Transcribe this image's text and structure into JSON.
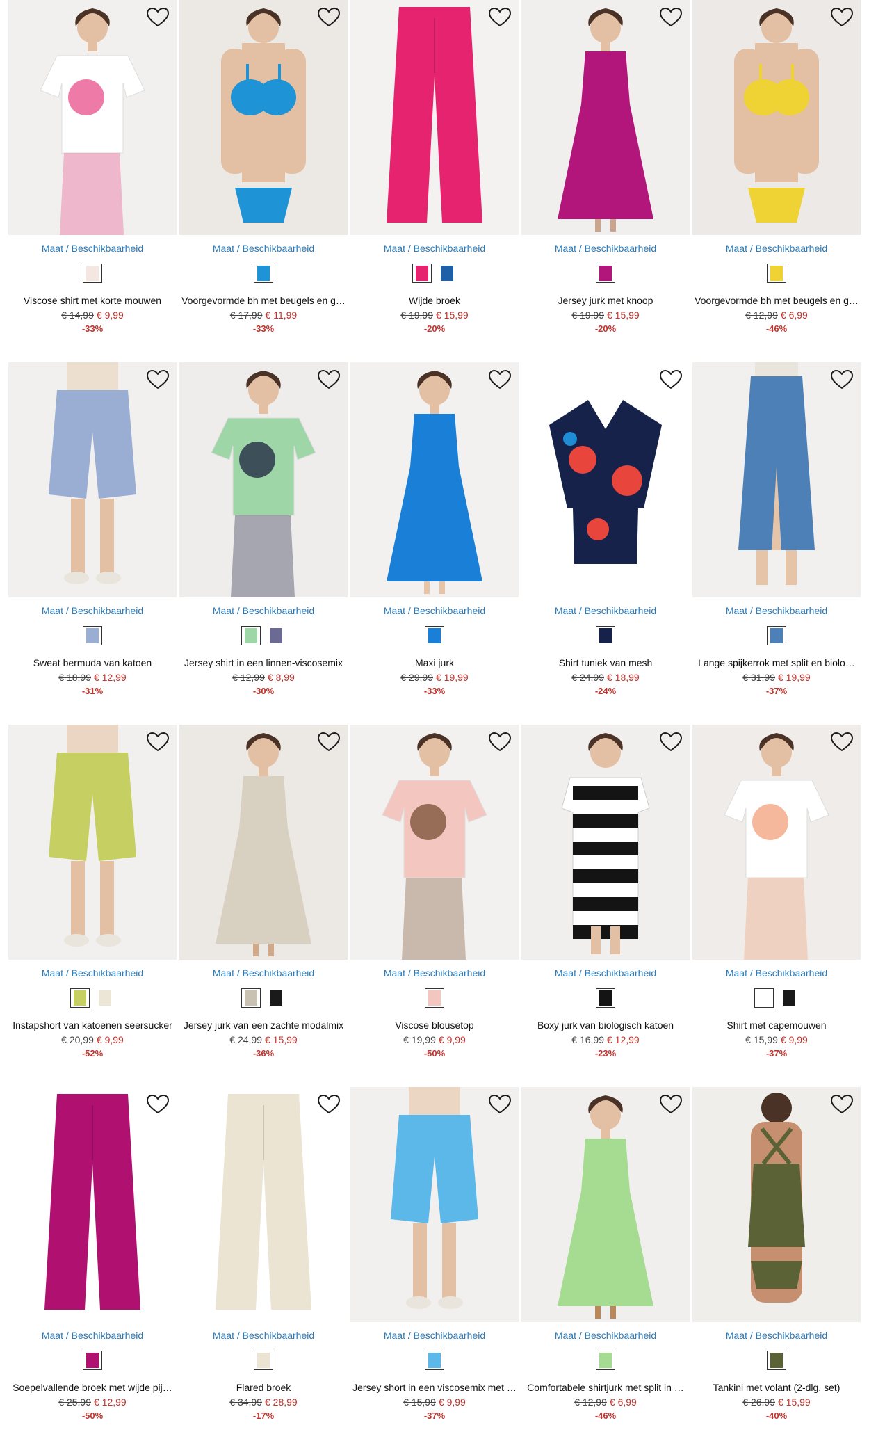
{
  "ui": {
    "availability_label": "Maat / Beschikbaarheid",
    "wishlist_icon": "heart-outline-icon",
    "colors": {
      "link": "#2b7bb9",
      "sale": "#c2342d"
    }
  },
  "products": [
    {
      "name": "Viscose shirt met korte mouwen",
      "old_price": "€ 14,99",
      "new_price": "€ 9,99",
      "discount": "-33%",
      "bg": "#f2f0ee",
      "item": "#ffffff",
      "accent": "#e84d8a",
      "shape": "top",
      "swatches": [
        "#f4e6e0"
      ]
    },
    {
      "name": "Voorgevormde bh met beugels en g…",
      "old_price": "€ 17,99",
      "new_price": "€ 11,99",
      "discount": "-33%",
      "bg": "#ece9e5",
      "item": "#1e94d6",
      "accent": "#c9a58d",
      "shape": "bra",
      "swatches": [
        "#1e94d6"
      ]
    },
    {
      "name": "Wijde broek",
      "old_price": "€ 19,99",
      "new_price": "€ 15,99",
      "discount": "-20%",
      "bg": "#f4f2f0",
      "item": "#e5236e",
      "accent": "#ffffff",
      "shape": "pants",
      "swatches": [
        "#e5236e",
        "#1f5fa8"
      ]
    },
    {
      "name": "Jersey jurk met knoop",
      "old_price": "€ 19,99",
      "new_price": "€ 15,99",
      "discount": "-20%",
      "bg": "#f1efed",
      "item": "#b3167a",
      "accent": "#c9a58d",
      "shape": "dress",
      "swatches": [
        "#b3167a"
      ]
    },
    {
      "name": "Voorgevormde bh met beugels en g…",
      "old_price": "€ 12,99",
      "new_price": "€ 6,99",
      "discount": "-46%",
      "bg": "#ece9e6",
      "item": "#efd335",
      "accent": "#d6a98b",
      "shape": "bra",
      "swatches": [
        "#efd335"
      ]
    },
    {
      "name": "Sweat bermuda van katoen",
      "old_price": "€ 18,99",
      "new_price": "€ 12,99",
      "discount": "-31%",
      "bg": "#f2f0ee",
      "item": "#9aaed3",
      "accent": "#e9d3bd",
      "shape": "shorts",
      "swatches": [
        "#9aaed3"
      ]
    },
    {
      "name": "Jersey shirt in een linnen-viscosemix",
      "old_price": "€ 12,99",
      "new_price": "€ 8,99",
      "discount": "-30%",
      "bg": "#efedeb",
      "item": "#9fd6a8",
      "accent": "#1c2340",
      "shape": "top",
      "swatches": [
        "#9fd6a8",
        "#6b6a93"
      ]
    },
    {
      "name": "Maxi jurk",
      "old_price": "€ 29,99",
      "new_price": "€ 19,99",
      "discount": "-33%",
      "bg": "#f3f1ef",
      "item": "#1a7fd6",
      "accent": "#e6c4a8",
      "shape": "dress",
      "swatches": [
        "#1a7fd6"
      ]
    },
    {
      "name": "Shirt tuniek van mesh",
      "old_price": "€ 24,99",
      "new_price": "€ 18,99",
      "discount": "-24%",
      "bg": "#ffffff",
      "item": "#16224a",
      "accent": "#e8453c",
      "shape": "tunic",
      "swatches": [
        "#16224a"
      ]
    },
    {
      "name": "Lange spijkerrok met split en biolo…",
      "old_price": "€ 31,99",
      "new_price": "€ 19,99",
      "discount": "-37%",
      "bg": "#f2f0ee",
      "item": "#4d80b6",
      "accent": "#e6c4a8",
      "shape": "skirt",
      "swatches": [
        "#4d80b6"
      ]
    },
    {
      "name": "Instapshort van katoenen seersucker",
      "old_price": "€ 20,99",
      "new_price": "€ 9,99",
      "discount": "-52%",
      "bg": "#f2f0ee",
      "item": "#c6cf62",
      "accent": "#e6c4a8",
      "shape": "shorts",
      "swatches": [
        "#c6cf62",
        "#ece6d6"
      ]
    },
    {
      "name": "Jersey jurk van een zachte modalmix",
      "old_price": "€ 24,99",
      "new_price": "€ 15,99",
      "discount": "-36%",
      "bg": "#ece8e3",
      "item": "#d8d1c2",
      "accent": "#d2a88a",
      "shape": "dress",
      "swatches": [
        "#c9c1b1",
        "#1a1a1a"
      ]
    },
    {
      "name": "Viscose blousetop",
      "old_price": "€ 19,99",
      "new_price": "€ 9,99",
      "discount": "-50%",
      "bg": "#f3f1ef",
      "item": "#f3c7c0",
      "accent": "#7a4f35",
      "shape": "top",
      "swatches": [
        "#f3c7c0"
      ]
    },
    {
      "name": "Boxy jurk van biologisch katoen",
      "old_price": "€ 16,99",
      "new_price": "€ 12,99",
      "discount": "-23%",
      "bg": "#f1efed",
      "item": "#141414",
      "accent": "#ffffff",
      "shape": "stripe",
      "swatches": [
        "#141414"
      ]
    },
    {
      "name": "Shirt met capemouwen",
      "old_price": "€ 15,99",
      "new_price": "€ 9,99",
      "discount": "-37%",
      "bg": "#efece9",
      "item": "#ffffff",
      "accent": "#f2a07c",
      "shape": "top",
      "swatches": [
        "#ffffff",
        "#1a1a1a"
      ]
    },
    {
      "name": "Soepelvallende broek met wijde pij…",
      "old_price": "€ 25,99",
      "new_price": "€ 12,99",
      "discount": "-50%",
      "bg": "#ffffff",
      "item": "#b0106f",
      "accent": "#b0106f",
      "shape": "pants",
      "swatches": [
        "#b0106f"
      ]
    },
    {
      "name": "Flared broek",
      "old_price": "€ 34,99",
      "new_price": "€ 28,99",
      "discount": "-17%",
      "bg": "#ffffff",
      "item": "#ebe4d3",
      "accent": "#8ea6c4",
      "shape": "pants",
      "swatches": [
        "#ebe4d3"
      ]
    },
    {
      "name": "Jersey short in een viscosemix met …",
      "old_price": "€ 15,99",
      "new_price": "€ 9,99",
      "discount": "-37%",
      "bg": "#f2f0ee",
      "item": "#5db8ea",
      "accent": "#e6c4a8",
      "shape": "shorts",
      "swatches": [
        "#5db8ea"
      ]
    },
    {
      "name": "Comfortabele shirtjurk met split in …",
      "old_price": "€ 12,99",
      "new_price": "€ 6,99",
      "discount": "-46%",
      "bg": "#f1efed",
      "item": "#a6dc92",
      "accent": "#b9875c",
      "shape": "dress",
      "swatches": [
        "#a6dc92"
      ]
    },
    {
      "name": "Tankini met volant (2-dlg. set)",
      "old_price": "€ 26,99",
      "new_price": "€ 15,99",
      "discount": "-40%",
      "bg": "#f0eeeb",
      "item": "#5b6235",
      "accent": "#c69070",
      "shape": "tankini",
      "swatches": [
        "#5b6235"
      ]
    }
  ]
}
